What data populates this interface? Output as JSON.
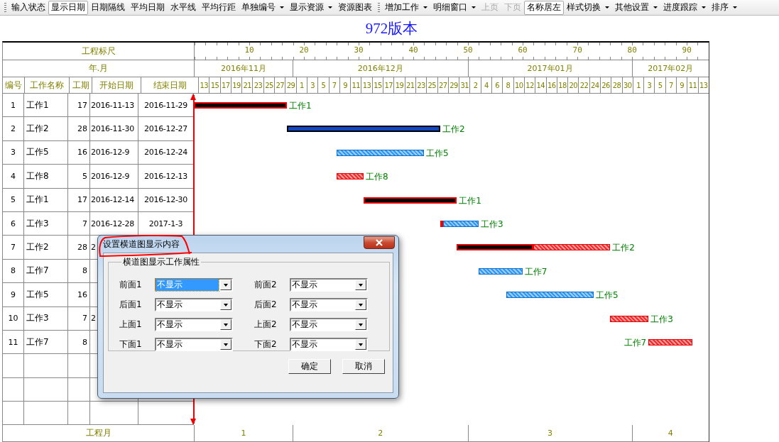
{
  "toolbar": {
    "groups": [
      [
        {
          "label": "输入状态",
          "kind": "button",
          "pressed": false,
          "disabled": false
        },
        {
          "label": "显示日期",
          "kind": "button",
          "pressed": true,
          "disabled": false
        },
        {
          "label": "日期隔线",
          "kind": "button",
          "pressed": false,
          "disabled": false
        },
        {
          "label": "平均日期",
          "kind": "button",
          "pressed": false,
          "disabled": false
        },
        {
          "label": "水平线",
          "kind": "button",
          "pressed": false,
          "disabled": false
        },
        {
          "label": "平均行距",
          "kind": "button",
          "pressed": false,
          "disabled": false
        },
        {
          "label": "单独编号",
          "kind": "dropdown",
          "pressed": false,
          "disabled": false
        },
        {
          "label": "显示资源",
          "kind": "dropdown",
          "pressed": false,
          "disabled": false
        },
        {
          "label": "资源图表",
          "kind": "button",
          "pressed": false,
          "disabled": false
        }
      ],
      [
        {
          "label": "增加工作",
          "kind": "dropdown",
          "pressed": false,
          "disabled": false
        },
        {
          "label": "明细窗口",
          "kind": "dropdown",
          "pressed": false,
          "disabled": false
        },
        {
          "label": "上页",
          "kind": "button",
          "pressed": false,
          "disabled": true
        },
        {
          "label": "下页",
          "kind": "button",
          "pressed": false,
          "disabled": true
        },
        {
          "label": "名称居左",
          "kind": "button",
          "pressed": true,
          "disabled": false
        },
        {
          "label": "样式切换",
          "kind": "dropdown",
          "pressed": false,
          "disabled": false
        },
        {
          "label": "其他设置",
          "kind": "dropdown",
          "pressed": false,
          "disabled": false
        },
        {
          "label": "进度跟踪",
          "kind": "dropdown",
          "pressed": false,
          "disabled": false
        },
        {
          "label": "排序",
          "kind": "dropdown",
          "pressed": false,
          "disabled": false
        }
      ]
    ]
  },
  "title": "972版本",
  "chart": {
    "ruler_label": "工程标尺",
    "ruler_ticks": [
      "10",
      "20",
      "30",
      "40",
      "50",
      "60",
      "70",
      "80",
      "90"
    ],
    "month_label": "年.月",
    "footer_label": "工程月",
    "columns": [
      "编号",
      "工作名称",
      "工期",
      "开始日期",
      "结束日期"
    ],
    "months": [
      {
        "label": "2016年11月",
        "footer": "1",
        "days": [
          "13",
          "15",
          "17",
          "19",
          "21",
          "23",
          "25",
          "27",
          "29"
        ]
      },
      {
        "label": "2016年12月",
        "footer": "2",
        "days": [
          "1",
          "3",
          "5",
          "7",
          "9",
          "11",
          "13",
          "15",
          "17",
          "19",
          "21",
          "23",
          "25",
          "27",
          "29",
          "31"
        ]
      },
      {
        "label": "2017年01月",
        "footer": "3",
        "days": [
          "2",
          "4",
          "6",
          "8",
          "10",
          "12",
          "14",
          "16",
          "18",
          "20",
          "22",
          "24",
          "26",
          "28",
          "30"
        ]
      },
      {
        "label": "2017年02月",
        "footer": "4",
        "days": [
          "1",
          "3",
          "5",
          "7",
          "9",
          "11",
          "13"
        ]
      }
    ],
    "rows": [
      {
        "no": "1",
        "name": "工作1",
        "duration": "17",
        "start": "2016-11-13",
        "end": "2016-11-29",
        "label": "工作1",
        "segments": [
          {
            "kind": "completed"
          }
        ]
      },
      {
        "no": "2",
        "name": "工作2",
        "duration": "28",
        "start": "2016-11-30",
        "end": "2016-12-27",
        "label": "工作2",
        "segments": [
          {
            "kind": "in-progress"
          }
        ]
      },
      {
        "no": "3",
        "name": "工作5",
        "duration": "16",
        "start": "2016-12-9",
        "end": "2016-12-24",
        "label": "工作5",
        "segments": [
          {
            "kind": "normal"
          }
        ]
      },
      {
        "no": "4",
        "name": "工作8",
        "duration": "5",
        "start": "2016-12-9",
        "end": "2016-12-13",
        "label": "工作8",
        "segments": [
          {
            "kind": "critical"
          }
        ]
      },
      {
        "no": "5",
        "name": "工作1",
        "duration": "17",
        "start": "2016-12-14",
        "end": "2016-12-30",
        "label": "工作1",
        "segments": [
          {
            "kind": "completed"
          }
        ]
      },
      {
        "no": "6",
        "name": "工作3",
        "duration": "7",
        "start": "2016-12-28",
        "end": "2017-1-3",
        "label": "工作3",
        "segments": [
          {
            "kind": "completed"
          },
          {
            "kind": "normal"
          }
        ]
      },
      {
        "no": "7",
        "name": "工作2",
        "duration": "28",
        "start": "2",
        "label": "工作2",
        "segments": [
          {
            "kind": "completed"
          },
          {
            "kind": "critical"
          }
        ]
      },
      {
        "no": "8",
        "name": "工作7",
        "duration": "8",
        "label": "工作7",
        "segments": [
          {
            "kind": "normal"
          }
        ]
      },
      {
        "no": "9",
        "name": "工作5",
        "duration": "16",
        "label": "工作5",
        "segments": [
          {
            "kind": "normal"
          }
        ]
      },
      {
        "no": "10",
        "name": "工作3",
        "duration": "7",
        "start": "2",
        "label": "工作3",
        "segments": [
          {
            "kind": "critical"
          }
        ]
      },
      {
        "no": "11",
        "name": "工作7",
        "duration": "8",
        "label": "工作7",
        "segments": [
          {
            "kind": "critical"
          }
        ]
      }
    ]
  },
  "dialog": {
    "title": "设置横道图显示内容",
    "group_label": "横道图显示工作属性",
    "fields": [
      {
        "label": "前面1",
        "value": "不显示",
        "focused": true
      },
      {
        "label": "前面2",
        "value": "不显示",
        "focused": false
      },
      {
        "label": "后面1",
        "value": "不显示",
        "focused": false
      },
      {
        "label": "后面2",
        "value": "不显示",
        "focused": false
      },
      {
        "label": "上面1",
        "value": "不显示",
        "focused": false
      },
      {
        "label": "上面2",
        "value": "不显示",
        "focused": false
      },
      {
        "label": "下面1",
        "value": "不显示",
        "focused": false
      },
      {
        "label": "下面2",
        "value": "不显示",
        "focused": false
      }
    ],
    "buttons": [
      "确定",
      "取消"
    ]
  }
}
